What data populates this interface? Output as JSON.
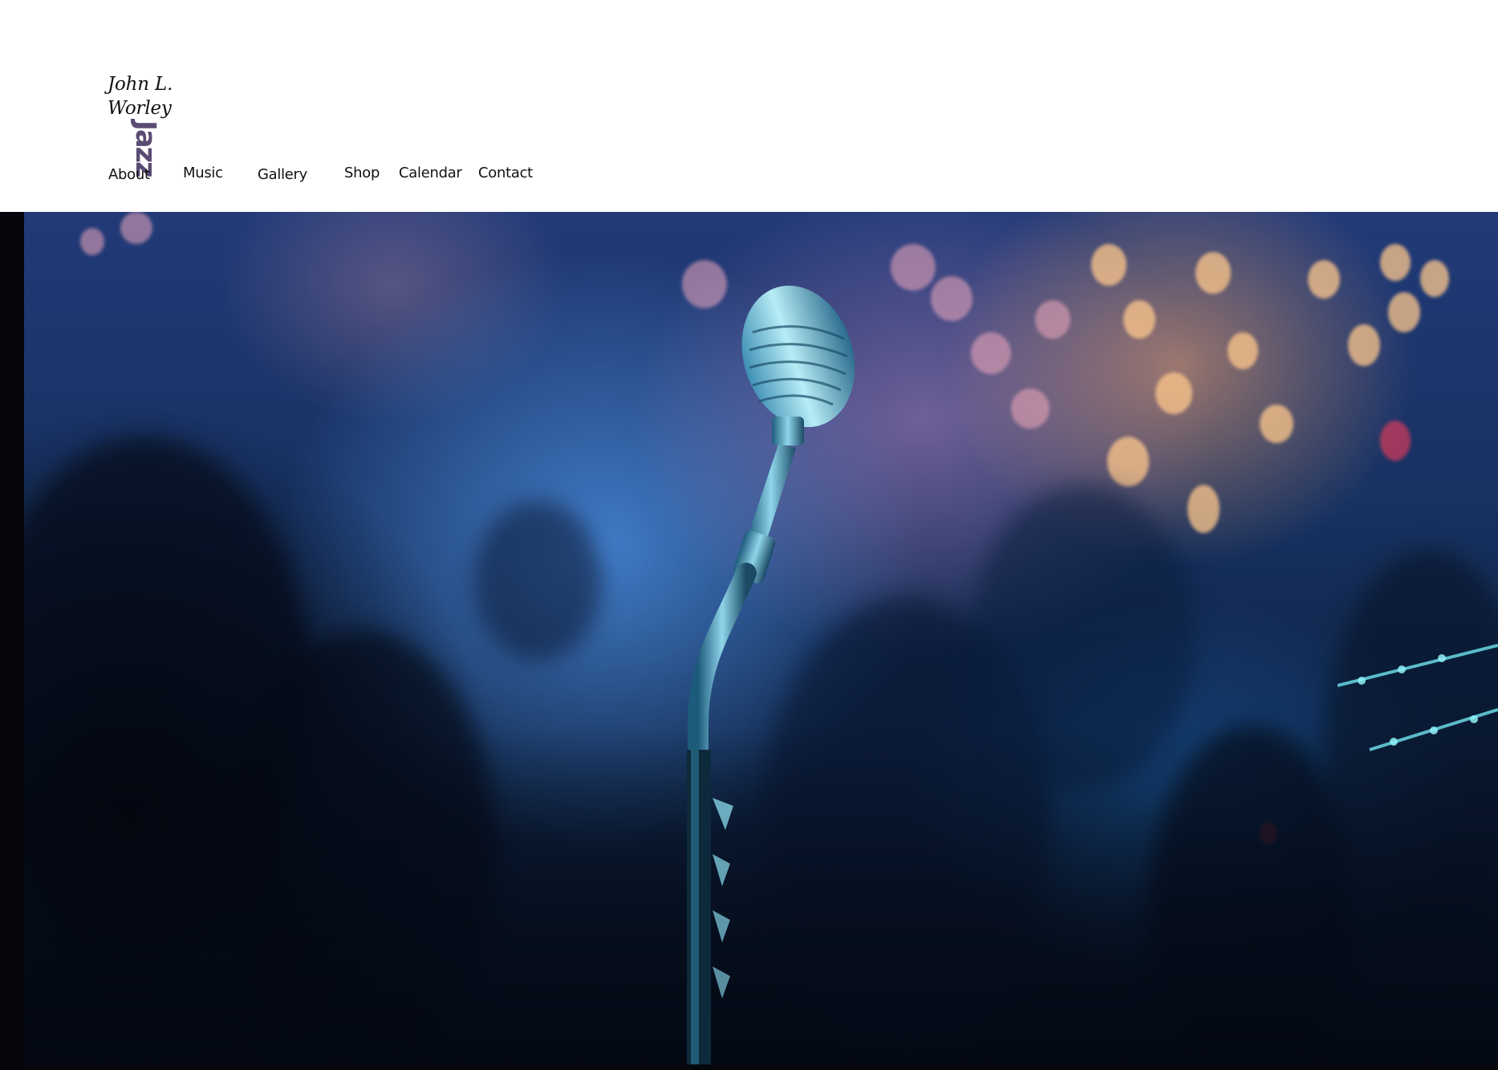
{
  "site": {
    "logo": {
      "line1": "John L.",
      "line2": "Worley",
      "mark": "Jazz",
      "mark_color": "#5a4b73"
    },
    "nav": [
      {
        "label": "About"
      },
      {
        "label": "Music"
      },
      {
        "label": "Gallery"
      },
      {
        "label": "Shop"
      },
      {
        "label": "Calendar"
      },
      {
        "label": "Contact"
      }
    ]
  },
  "colors": {
    "header_bg": "#ffffff",
    "text": "#111111",
    "hero_frame": "#05070d"
  }
}
